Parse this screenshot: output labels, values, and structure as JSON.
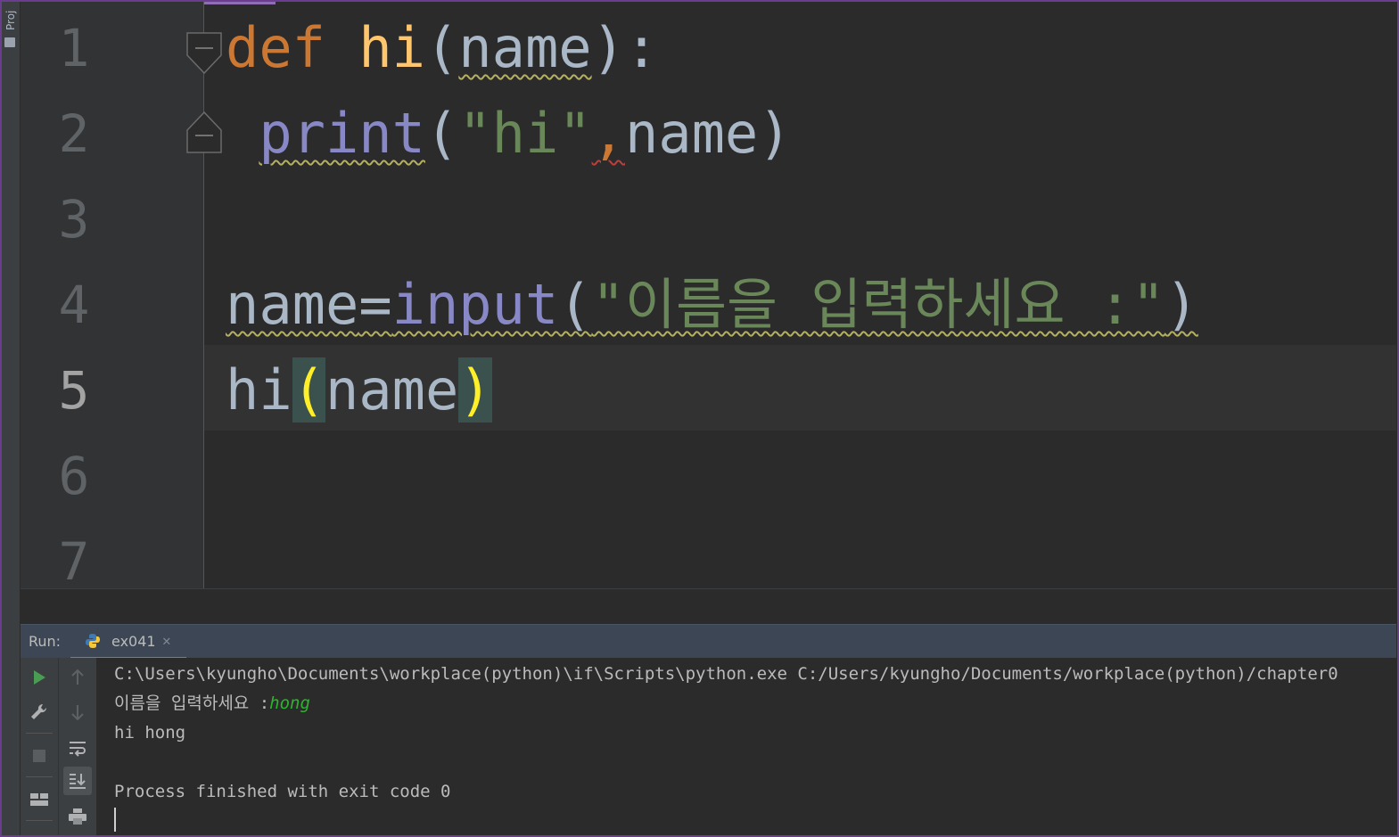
{
  "sidebar": {
    "project_label": "Proj"
  },
  "editor": {
    "line_numbers": [
      "1",
      "2",
      "3",
      "4",
      "5",
      "6",
      "7"
    ],
    "code": {
      "l1": {
        "kw": "def",
        "sp": " ",
        "fn": "hi",
        "rest_open": "(",
        "param": "name",
        "rest_close": "):"
      },
      "l2": {
        "indent": " ",
        "call": "print",
        "open": "(",
        "str": "\"hi\"",
        "comma": ",",
        "arg": "name",
        "close": ")"
      },
      "l4": {
        "var": "name",
        "eq": "=",
        "call": "input",
        "open": "(",
        "str": "\"이름을 입력하세요 :\"",
        "close": ")"
      },
      "l5": {
        "call": "hi",
        "open": "(",
        "arg": "name",
        "close": ")"
      }
    }
  },
  "run": {
    "title": "Run:",
    "tab_name": "ex041",
    "tab_close": "✕",
    "console": {
      "command": "C:\\Users\\kyungho\\Documents\\workplace(python)\\if\\Scripts\\python.exe C:/Users/kyungho/Documents/workplace(python)/chapter0",
      "prompt": "이름을 입력하세요 :",
      "user_input": "hong",
      "output": "hi hong",
      "exit": "Process finished with exit code 0"
    },
    "tool_icons": [
      "play-icon",
      "wrench-icon",
      "stop-icon",
      "layout-icon",
      "arrow-up-icon",
      "arrow-down-icon",
      "soft-wrap-icon",
      "scroll-to-end-icon",
      "print-icon"
    ]
  },
  "colors": {
    "keyword": "#cc7832",
    "function": "#ffc66d",
    "builtin": "#8888c6",
    "string": "#6a8759",
    "bracket_match": "#ffef28",
    "user_input": "#2db52d",
    "run_header": "#3c4654"
  }
}
